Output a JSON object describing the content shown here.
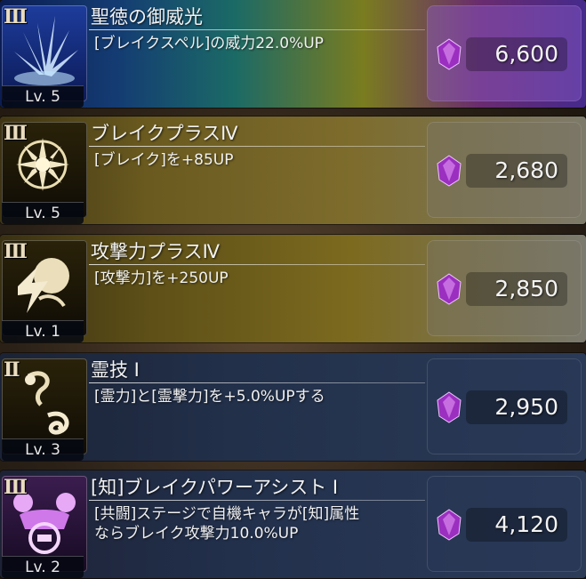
{
  "skills": [
    {
      "rank": "III",
      "level": "Lv. 5",
      "title": "聖徳の御威光",
      "desc": [
        "[ブレイクスペル]の威力22.0%UP"
      ],
      "cost": "6,600",
      "icon": "ice-burst-icon"
    },
    {
      "rank": "III",
      "level": "Lv. 5",
      "title": "ブレイクプラスⅣ",
      "desc": [
        "[ブレイク]を+85UP"
      ],
      "cost": "2,680",
      "icon": "break-star-icon"
    },
    {
      "rank": "III",
      "level": "Lv. 1",
      "title": "攻撃力プラスⅣ",
      "desc": [
        "[攻撃力]を+250UP"
      ],
      "cost": "2,850",
      "icon": "attack-orb-icon"
    },
    {
      "rank": "II",
      "level": "Lv. 3",
      "title": "霊技 Ⅰ",
      "desc": [
        "[霊力]と[霊撃力]を+5.0%UPする"
      ],
      "cost": "2,950",
      "icon": "spirit-flame-icon"
    },
    {
      "rank": "III",
      "level": "Lv. 2",
      "title": "[知]ブレイクパワーアシスト Ⅰ",
      "desc": [
        "[共闘]ステージで自機キャラが[知]属性",
        "ならブレイク攻撃力10.0%UP"
      ],
      "cost": "4,120",
      "icon": "assist-power-icon"
    }
  ],
  "colors": {
    "gem": "#9b2fc0",
    "gem_highlight": "#e39af5"
  }
}
